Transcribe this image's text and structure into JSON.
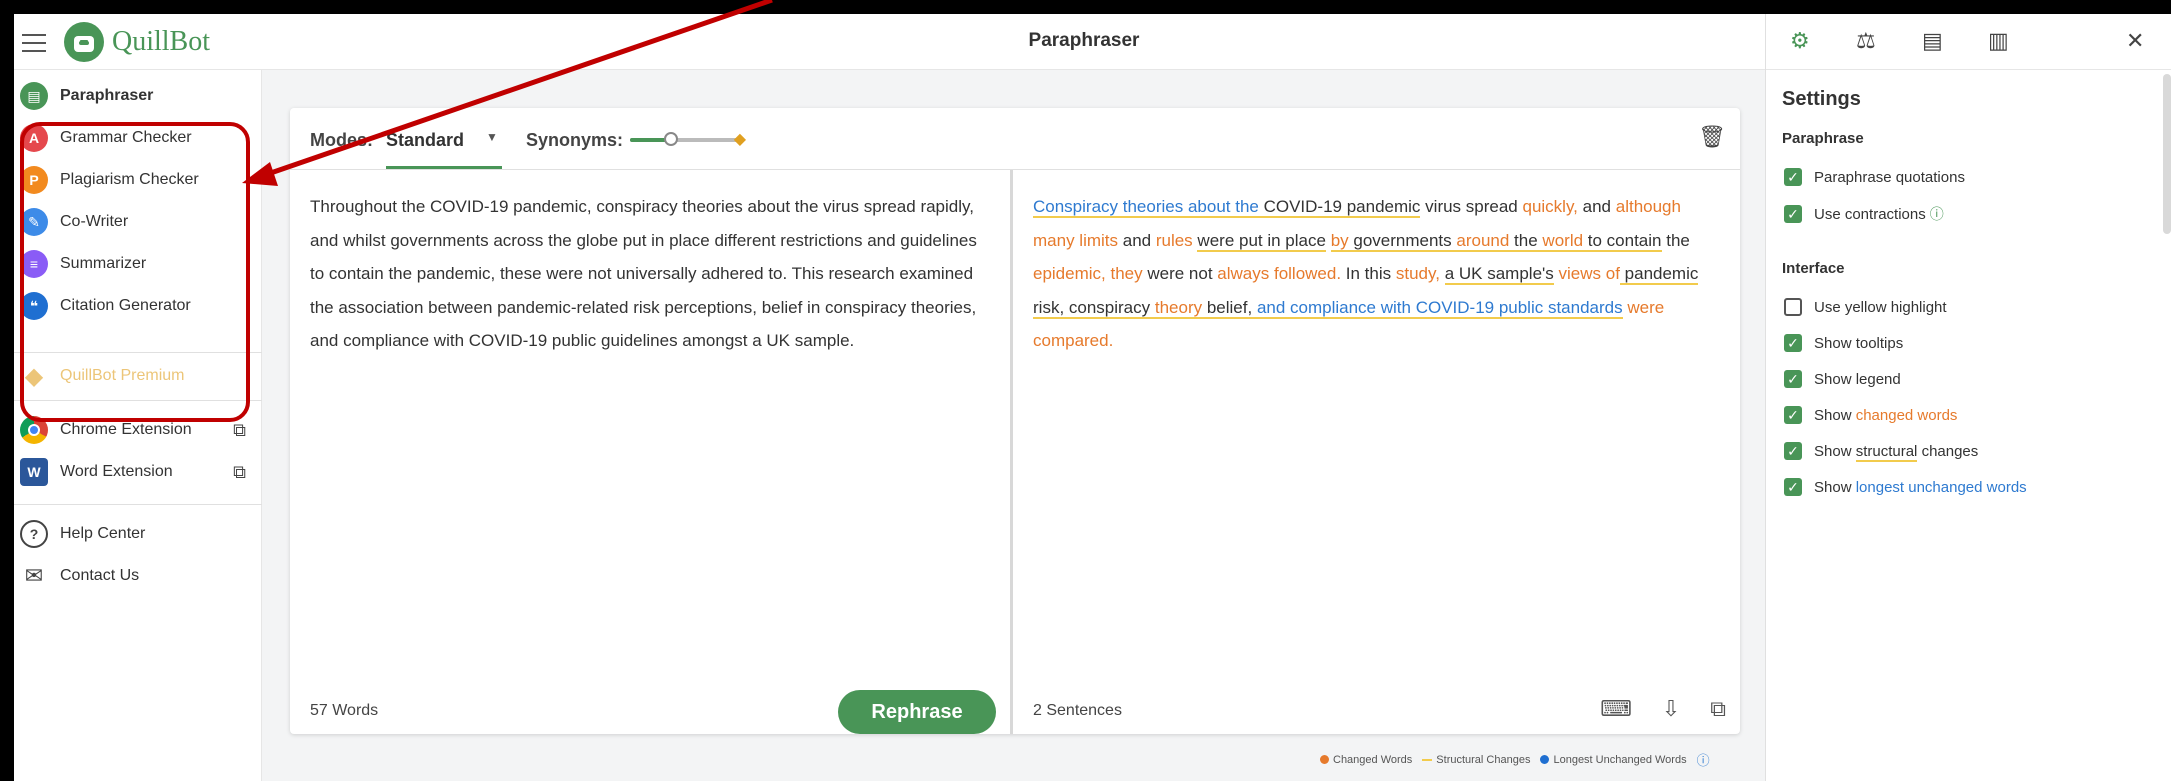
{
  "app": {
    "name": "QuillBot",
    "page_title": "Paraphraser"
  },
  "sidebar": {
    "items": [
      {
        "label": "Paraphraser",
        "icon": "paraphraser-icon",
        "color": "#499557",
        "glyph": "▤"
      },
      {
        "label": "Grammar Checker",
        "icon": "grammar-icon",
        "color": "#e5484d",
        "glyph": "A"
      },
      {
        "label": "Plagiarism Checker",
        "icon": "plagiarism-icon",
        "color": "#f28a1f",
        "glyph": "P"
      },
      {
        "label": "Co-Writer",
        "icon": "pen-icon",
        "color": "#3d8be8",
        "glyph": "✎"
      },
      {
        "label": "Summarizer",
        "icon": "summarizer-icon",
        "color": "#8a5cf6",
        "glyph": "≡"
      },
      {
        "label": "Citation Generator",
        "icon": "citation-icon",
        "color": "#1f6fd1",
        "glyph": "❝"
      }
    ],
    "premium_label": "QuillBot Premium",
    "extensions": [
      {
        "label": "Chrome Extension"
      },
      {
        "label": "Word Extension"
      }
    ],
    "support": [
      {
        "label": "Help Center"
      },
      {
        "label": "Contact Us"
      }
    ]
  },
  "editor": {
    "modes_label": "Modes:",
    "mode_value": "Standard",
    "synonyms_label": "Synonyms:",
    "input_text": "Throughout the COVID-19 pandemic, conspiracy theories about the virus spread rapidly, and whilst governments across the globe put in place different restrictions and guidelines to contain the pandemic, these were not universally adhered to. This research examined the association between pandemic-related risk perceptions, belief in conspiracy theories, and compliance with COVID-19 public guidelines amongst a UK sample.",
    "word_count": "57 Words",
    "rephrase_label": "Rephrase",
    "sentence_count": "2 Sentences",
    "output_segments": [
      {
        "t": "Conspiracy theories about the",
        "c": "blue",
        "u": true
      },
      {
        "t": " ",
        "c": "",
        "u": true
      },
      {
        "t": "COVID-19 pandemic",
        "c": "",
        "u": true
      },
      {
        "t": " virus spread ",
        "c": "",
        "u": false
      },
      {
        "t": "quickly,",
        "c": "orange",
        "u": false
      },
      {
        "t": " and ",
        "c": "",
        "u": false
      },
      {
        "t": "although many limits",
        "c": "orange",
        "u": false
      },
      {
        "t": " and ",
        "c": "",
        "u": false
      },
      {
        "t": "rules",
        "c": "orange",
        "u": false
      },
      {
        "t": " ",
        "c": "",
        "u": false
      },
      {
        "t": "were put in place",
        "c": "",
        "u": true
      },
      {
        "t": " ",
        "c": "",
        "u": false
      },
      {
        "t": "by",
        "c": "orange",
        "u": true
      },
      {
        "t": " governments ",
        "c": "",
        "u": true
      },
      {
        "t": "around",
        "c": "orange",
        "u": true
      },
      {
        "t": " the ",
        "c": "",
        "u": true
      },
      {
        "t": "world",
        "c": "orange",
        "u": true
      },
      {
        "t": " to contain",
        "c": "",
        "u": true
      },
      {
        "t": " the ",
        "c": "",
        "u": false
      },
      {
        "t": "epidemic, they",
        "c": "orange",
        "u": false
      },
      {
        "t": " were not ",
        "c": "",
        "u": false
      },
      {
        "t": "always followed.",
        "c": "orange",
        "u": false
      },
      {
        "t": " In this ",
        "c": "",
        "u": false
      },
      {
        "t": "study,",
        "c": "orange",
        "u": false
      },
      {
        "t": " ",
        "c": "",
        "u": false
      },
      {
        "t": "a UK sample's",
        "c": "",
        "u": true
      },
      {
        "t": " ",
        "c": "",
        "u": false
      },
      {
        "t": "views of",
        "c": "orange",
        "u": false
      },
      {
        "t": " pandemic risk, conspiracy ",
        "c": "",
        "u": true
      },
      {
        "t": "theory",
        "c": "orange",
        "u": true
      },
      {
        "t": " belief, ",
        "c": "",
        "u": true
      },
      {
        "t": "and compliance with COVID-19 public standards",
        "c": "blue",
        "u": true
      },
      {
        "t": " ",
        "c": "",
        "u": false
      },
      {
        "t": "were compared.",
        "c": "orange",
        "u": false
      }
    ]
  },
  "legend": {
    "changed": "Changed Words",
    "structural": "Structural Changes",
    "unchanged": "Longest Unchanged Words"
  },
  "settings": {
    "title": "Settings",
    "paraphrase_section": "Paraphrase",
    "paraphrase_options": [
      {
        "label": "Paraphrase quotations",
        "checked": true
      },
      {
        "label": "Use contractions",
        "checked": true
      }
    ],
    "interface_section": "Interface",
    "use_yellow_highlight": "Use yellow highlight",
    "show_tooltips": "Show tooltips",
    "show_legend": "Show legend",
    "show_prefix": "Show",
    "changed_words": "changed words",
    "structural": "structural",
    "changes": "changes",
    "longest_unchanged": "longest unchanged words"
  },
  "colors": {
    "accent": "#499557",
    "changed": "#e67a2c",
    "unchanged": "#2e7ad0",
    "structural": "#f2cb4c",
    "annotation": "#c00000"
  }
}
